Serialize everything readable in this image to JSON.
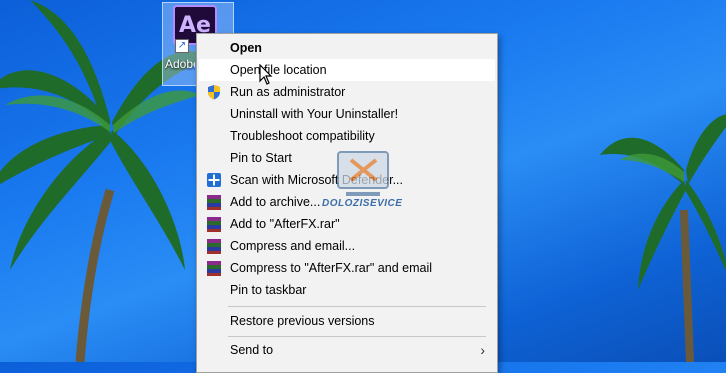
{
  "desktop": {
    "icon_label": "Adobe After Effects",
    "icon_text": "Ae"
  },
  "context_menu": {
    "items": [
      {
        "label": "Open",
        "bold": true
      },
      {
        "label": "Open file location"
      },
      {
        "label": "Run as administrator",
        "icon": "uac-shield-icon"
      },
      {
        "label": "Uninstall with Your Uninstaller!"
      },
      {
        "label": "Troubleshoot compatibility"
      },
      {
        "label": "Pin to Start"
      },
      {
        "label": "Scan with Microsoft Defender...",
        "icon": "defender-icon"
      },
      {
        "label": "Add to archive...",
        "icon": "winrar-icon"
      },
      {
        "label": "Add to \"AfterFX.rar\"",
        "icon": "winrar-icon"
      },
      {
        "label": "Compress and email...",
        "icon": "winrar-icon"
      },
      {
        "label": "Compress to \"AfterFX.rar\" and email",
        "icon": "winrar-icon"
      },
      {
        "label": "Pin to taskbar"
      },
      {
        "label": "Restore previous versions"
      },
      {
        "label": "Send to",
        "submenu_icon": "chevron-right-icon"
      }
    ],
    "hovered": "Open file location"
  },
  "watermark": {
    "text": "DOLOZISEVICE"
  },
  "colors": {
    "desktop_blue": "#1a7af0",
    "menu_bg": "#f2f2f2",
    "ae_purple": "#cdb3ff"
  }
}
